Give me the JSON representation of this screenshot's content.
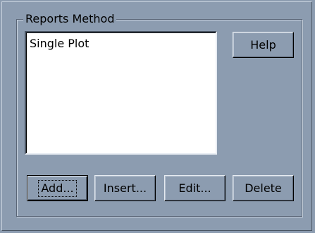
{
  "groupbox": {
    "title": "Reports Method"
  },
  "methods_list": {
    "items": [
      "Single Plot"
    ]
  },
  "buttons": {
    "help": "Help",
    "add": "Add...",
    "insert": "Insert...",
    "edit": "Edit...",
    "delete": "Delete"
  },
  "colors": {
    "panel_bg": "#8c9cb0",
    "list_bg": "#ffffff"
  }
}
